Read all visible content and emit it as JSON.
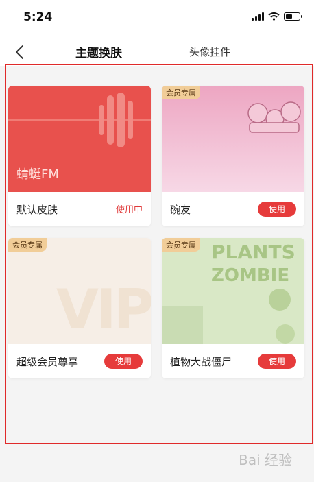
{
  "status_bar": {
    "time": "5:24"
  },
  "nav": {
    "back_icon": "chevron-left",
    "tabs": [
      {
        "label": "主题换肤",
        "active": true
      },
      {
        "label": "头像挂件",
        "active": false
      }
    ]
  },
  "themes": [
    {
      "name": "默认皮肤",
      "action": "使用中",
      "badge": "",
      "brand": "蜻蜓FM",
      "in_use": true
    },
    {
      "name": "碗友",
      "action": "使用",
      "badge": "会员专属",
      "in_use": false
    },
    {
      "name": "超级会员尊享",
      "action": "使用",
      "badge": "会员专属",
      "image_text": "VIP",
      "in_use": false
    },
    {
      "name": "植物大战僵尸",
      "action": "使用",
      "badge": "会员专属",
      "logo_top": "PLANTS",
      "logo_bottom": "ZOMBIE",
      "in_use": false
    }
  ],
  "watermark": "Bai 经验",
  "colors": {
    "accent": "#e63b3b",
    "badge": "#f1cd98",
    "default_skin": "#e8514d"
  }
}
